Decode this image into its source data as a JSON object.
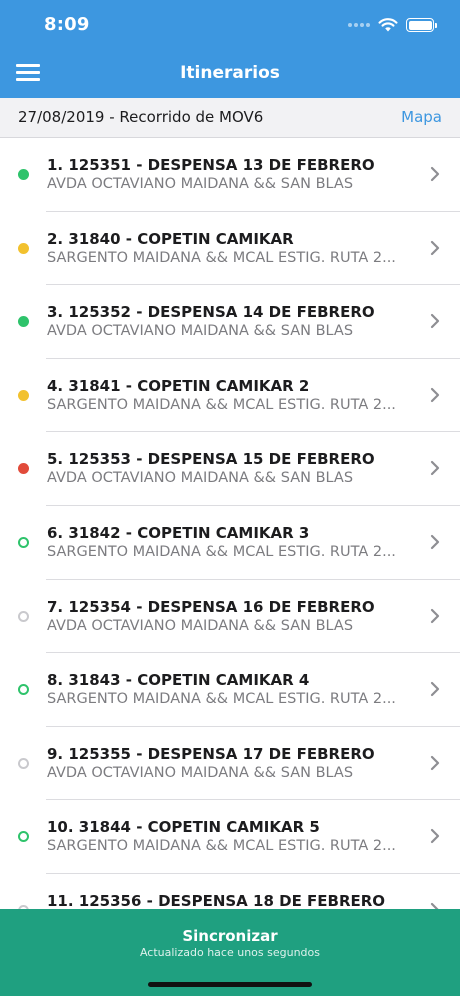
{
  "status_bar": {
    "time": "8:09"
  },
  "nav": {
    "title": "Itinerarios",
    "menu_icon": "hamburger-menu-icon"
  },
  "route": {
    "title": "27/08/2019 - Recorrido de MOV6",
    "map_link": "Mapa"
  },
  "colors": {
    "header": "#3d97e0",
    "accent_link": "#3d97e0",
    "sync_bar": "#1fa080",
    "status_green": "#2ec36b",
    "status_yellow": "#f2c12e",
    "status_red": "#e14b3a",
    "status_pending": "#c9c9cd"
  },
  "itinerary": [
    {
      "title": "1. 125351 - DESPENSA 13 DE FEBRERO",
      "address": "AVDA OCTAVIANO MAIDANA  && SAN BLAS",
      "status": "filled-green"
    },
    {
      "title": "2. 31840 - COPETIN CAMIKAR",
      "address": "SARGENTO MAIDANA  && MCAL ESTIG. RUTA 2...",
      "status": "filled-yellow"
    },
    {
      "title": "3. 125352 - DESPENSA 14 DE FEBRERO",
      "address": "AVDA OCTAVIANO MAIDANA  && SAN BLAS",
      "status": "filled-green"
    },
    {
      "title": "4. 31841 - COPETIN CAMIKAR 2",
      "address": "SARGENTO MAIDANA  && MCAL ESTIG. RUTA 2...",
      "status": "filled-yellow"
    },
    {
      "title": "5. 125353 - DESPENSA 15 DE FEBRERO",
      "address": "AVDA OCTAVIANO MAIDANA  && SAN BLAS",
      "status": "filled-red"
    },
    {
      "title": "6. 31842 - COPETIN CAMIKAR 3",
      "address": "SARGENTO MAIDANA  && MCAL ESTIG. RUTA 2...",
      "status": "ring-green"
    },
    {
      "title": "7. 125354 - DESPENSA 16 DE FEBRERO",
      "address": "AVDA OCTAVIANO MAIDANA  && SAN BLAS",
      "status": "ring-gray"
    },
    {
      "title": "8. 31843 - COPETIN CAMIKAR 4",
      "address": "SARGENTO MAIDANA  && MCAL ESTIG. RUTA 2...",
      "status": "ring-green"
    },
    {
      "title": "9. 125355 - DESPENSA 17 DE FEBRERO",
      "address": "AVDA OCTAVIANO MAIDANA  && SAN BLAS",
      "status": "ring-gray"
    },
    {
      "title": "10. 31844 - COPETIN CAMIKAR 5",
      "address": "SARGENTO MAIDANA  && MCAL ESTIG. RUTA 2...",
      "status": "ring-green"
    },
    {
      "title": "11. 125356 - DESPENSA 18 DE FEBRERO",
      "address": "",
      "status": "ring-gray"
    }
  ],
  "sync": {
    "label": "Sincronizar",
    "subtitle": "Actualizado hace unos segundos"
  }
}
